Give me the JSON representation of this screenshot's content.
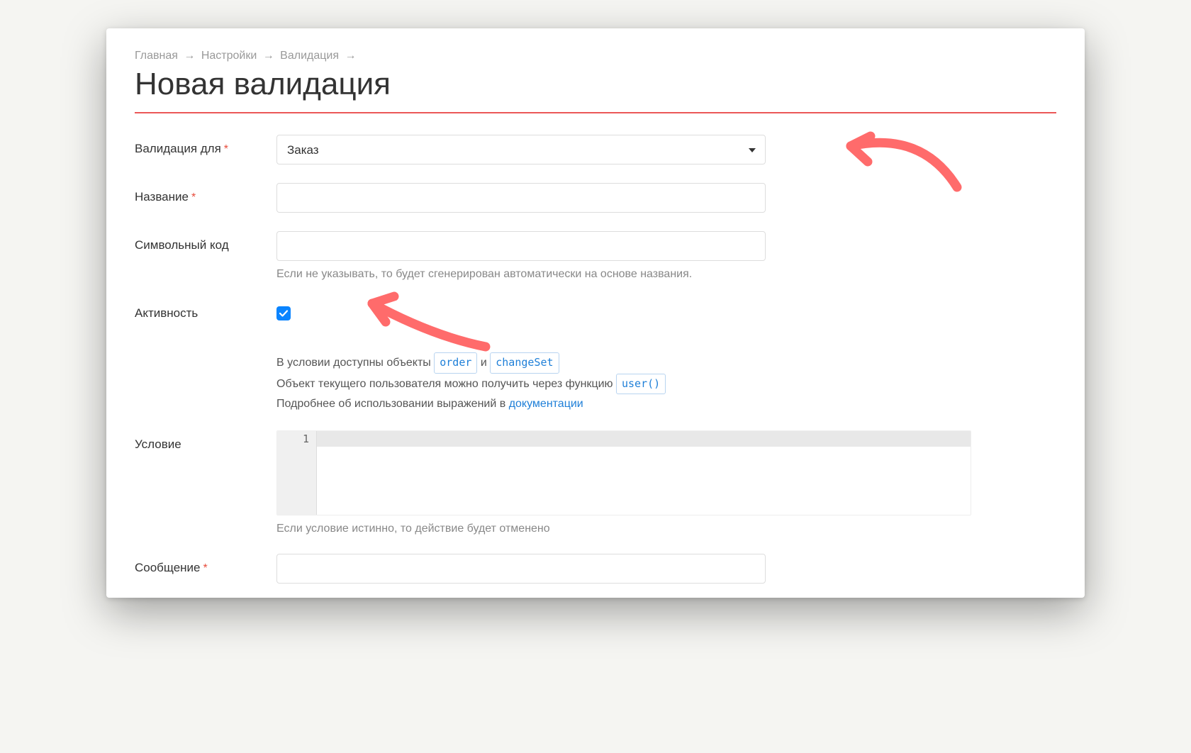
{
  "breadcrumb": {
    "items": [
      "Главная",
      "Настройки",
      "Валидация"
    ],
    "separator": "→"
  },
  "page": {
    "title": "Новая валидация"
  },
  "form": {
    "validation_for": {
      "label": "Валидация для",
      "required": true,
      "selected": "Заказ"
    },
    "name": {
      "label": "Название",
      "required": true,
      "value": ""
    },
    "symbol_code": {
      "label": "Символьный код",
      "required": false,
      "value": "",
      "help": "Если не указывать, то будет сгенерирован автоматически на основе названия."
    },
    "active": {
      "label": "Активность",
      "checked": true
    },
    "condition_hint": {
      "line1_prefix": "В условии доступны объекты ",
      "code1": "order",
      "line1_mid": " и ",
      "code2": "changeSet",
      "line2_prefix": "Объект текущего пользователя можно получить через функцию ",
      "code3": "user()",
      "line3_prefix": "Подробнее об использовании выражений в ",
      "doc_link_text": "документации"
    },
    "condition": {
      "label": "Условие",
      "gutter_line": "1",
      "value": "",
      "help": "Если условие истинно, то действие будет отменено"
    },
    "message": {
      "label": "Сообщение",
      "required": true,
      "value": ""
    }
  }
}
